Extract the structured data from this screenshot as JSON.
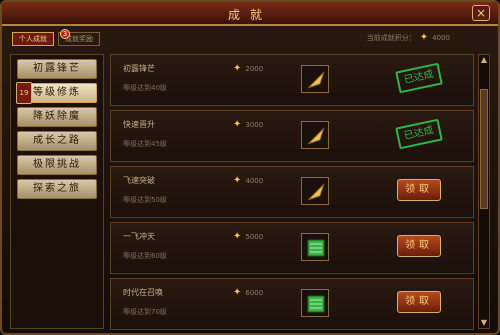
{
  "window": {
    "title": "成就"
  },
  "tabs": [
    {
      "label": "个人成就",
      "active": true
    },
    {
      "label": "成就奖励",
      "active": false
    }
  ],
  "tab_badge": "3",
  "score": {
    "label": "当前成就积分：",
    "value": "4000"
  },
  "sidebar": {
    "items": [
      {
        "label": "初露锋芒"
      },
      {
        "label": "等级修炼",
        "badge": "19"
      },
      {
        "label": "降妖除魔"
      },
      {
        "label": "成长之路"
      },
      {
        "label": "极限挑战"
      },
      {
        "label": "探索之旅"
      }
    ]
  },
  "rows": [
    {
      "name": "初露锋芒",
      "reward": "2000",
      "req": "等级达到40级",
      "icon": "gold-feather-icon",
      "state": "done",
      "state_label": "已达成"
    },
    {
      "name": "快速晋升",
      "reward": "3000",
      "req": "等级达到45级",
      "icon": "gold-feather-icon",
      "state": "done",
      "state_label": "已达成"
    },
    {
      "name": "飞速突破",
      "reward": "4000",
      "req": "等级达到50级",
      "icon": "gold-feather-icon",
      "state": "claim",
      "state_label": "领取"
    },
    {
      "name": "一飞冲天",
      "reward": "5000",
      "req": "等级达到60级",
      "icon": "green-book-icon",
      "state": "claim",
      "state_label": "领取"
    },
    {
      "name": "时代在召唤",
      "reward": "6000",
      "req": "等级达到70级",
      "icon": "green-book-icon",
      "state": "claim",
      "state_label": "领取"
    }
  ],
  "colors": {
    "accent_gold": "#f3d07a",
    "done_green": "#2fb44a",
    "claim_red": "#b84a1c"
  }
}
